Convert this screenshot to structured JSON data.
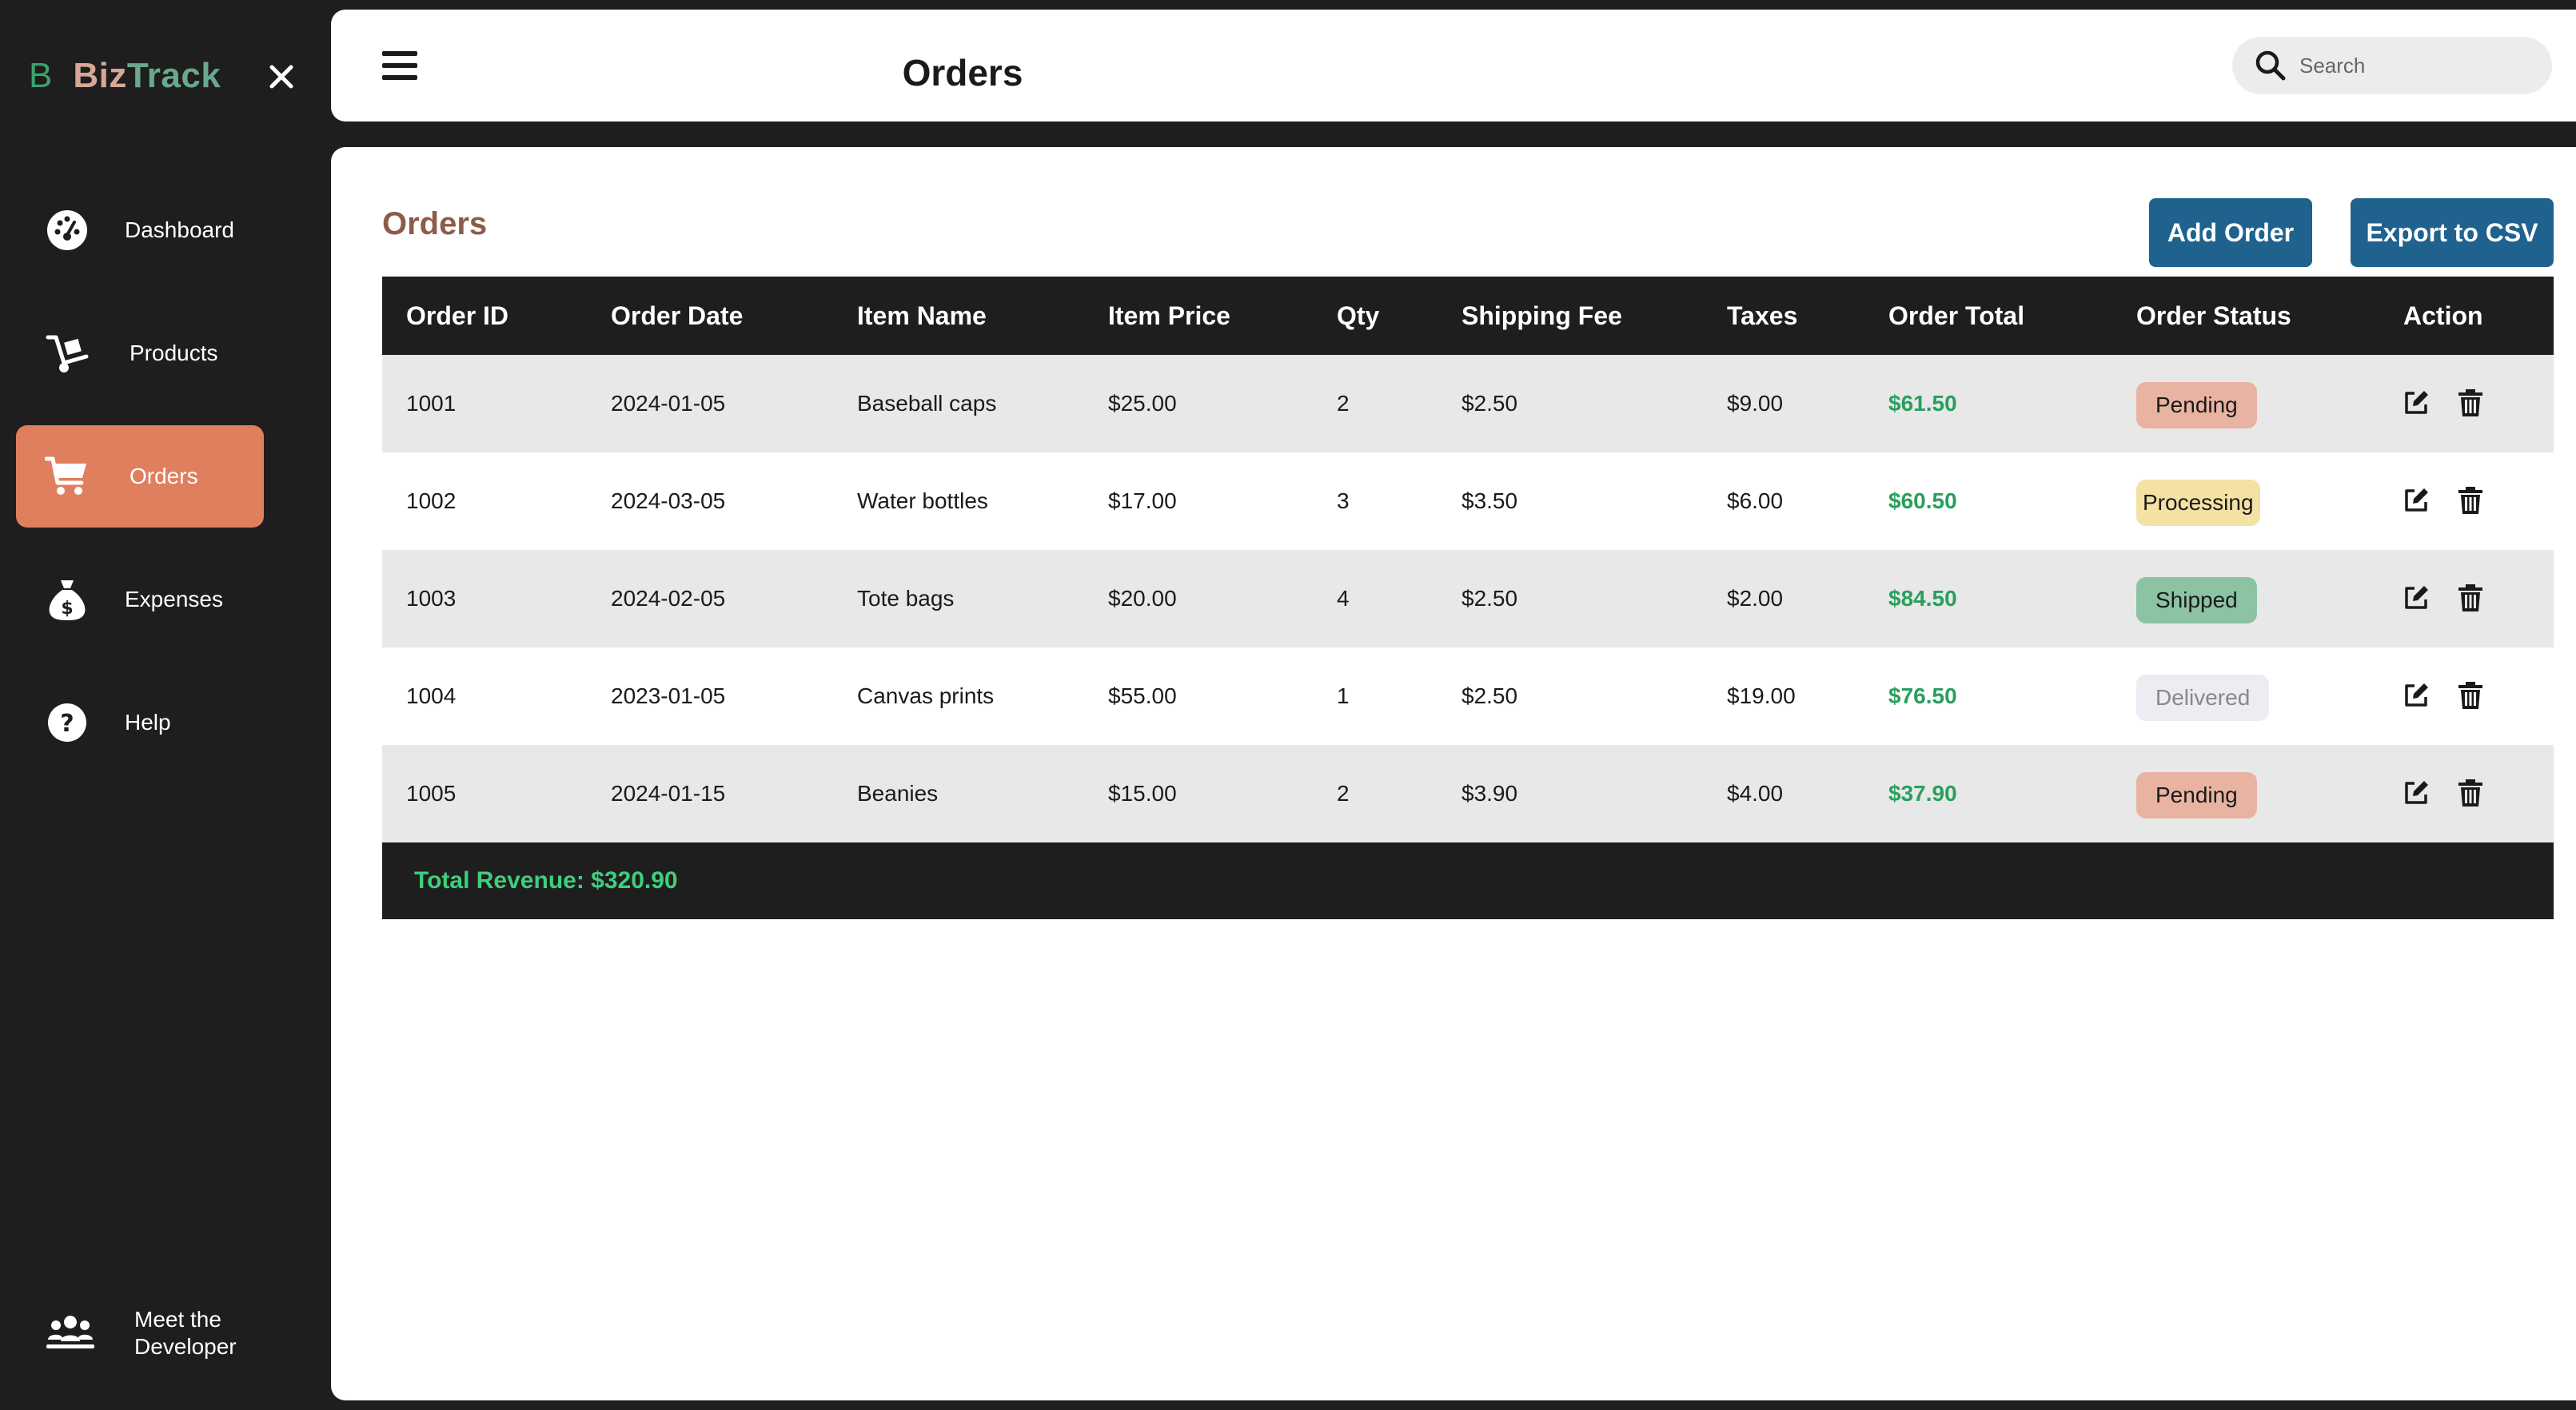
{
  "sidebar": {
    "brand_mark": "B",
    "brand_part1": "Biz",
    "brand_part2": "Track",
    "items": [
      {
        "label": "Dashboard",
        "icon": "dashboard-gauge-icon",
        "active": false
      },
      {
        "label": "Products",
        "icon": "hand-truck-icon",
        "active": false
      },
      {
        "label": "Orders",
        "icon": "cart-icon",
        "active": true
      },
      {
        "label": "Expenses",
        "icon": "money-bag-icon",
        "active": false
      },
      {
        "label": "Help",
        "icon": "question-circle-icon",
        "active": false
      }
    ],
    "developer_label_line1": "Meet the",
    "developer_label_line2": "Developer"
  },
  "header": {
    "title": "Orders",
    "search_placeholder": "Search"
  },
  "main": {
    "section_title": "Orders",
    "add_button": "Add Order",
    "export_button": "Export to CSV",
    "columns": [
      "Order ID",
      "Order Date",
      "Item Name",
      "Item Price",
      "Qty",
      "Shipping Fee",
      "Taxes",
      "Order Total",
      "Order Status",
      "Action"
    ],
    "rows": [
      {
        "id": "1001",
        "date": "2024-01-05",
        "item": "Baseball caps",
        "price": "$25.00",
        "qty": "2",
        "shipping": "$2.50",
        "taxes": "$9.00",
        "total": "$61.50",
        "status": "Pending"
      },
      {
        "id": "1002",
        "date": "2024-03-05",
        "item": "Water bottles",
        "price": "$17.00",
        "qty": "3",
        "shipping": "$3.50",
        "taxes": "$6.00",
        "total": "$60.50",
        "status": "Processing"
      },
      {
        "id": "1003",
        "date": "2024-02-05",
        "item": "Tote bags",
        "price": "$20.00",
        "qty": "4",
        "shipping": "$2.50",
        "taxes": "$2.00",
        "total": "$84.50",
        "status": "Shipped"
      },
      {
        "id": "1004",
        "date": "2023-01-05",
        "item": "Canvas prints",
        "price": "$55.00",
        "qty": "1",
        "shipping": "$2.50",
        "taxes": "$19.00",
        "total": "$76.50",
        "status": "Delivered"
      },
      {
        "id": "1005",
        "date": "2024-01-15",
        "item": "Beanies",
        "price": "$15.00",
        "qty": "2",
        "shipping": "$3.90",
        "taxes": "$4.00",
        "total": "$37.90",
        "status": "Pending"
      }
    ],
    "total_revenue": "Total Revenue: $320.90"
  },
  "colors": {
    "accent": "#e07f5e",
    "button": "#1f628e",
    "sidebar_bg": "#1e1e1e",
    "total_green": "#27a05d",
    "section_title": "#8c5b49",
    "pending": "#e8b4a1",
    "processing": "#f4e1a4",
    "shipped": "#8bc3a3",
    "delivered": "#ececf2"
  }
}
